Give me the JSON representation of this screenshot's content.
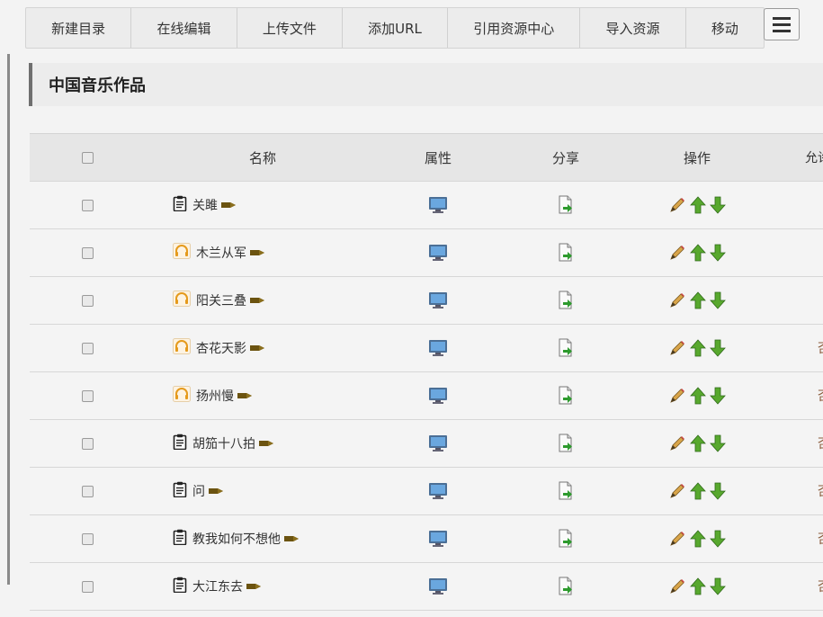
{
  "toolbar": {
    "buttons": [
      "新建目录",
      "在线编辑",
      "上传文件",
      "添加URL",
      "引用资源中心",
      "导入资源",
      "移动"
    ]
  },
  "section": {
    "title": "中国音乐作品"
  },
  "table": {
    "headers": {
      "name": "名称",
      "attr": "属性",
      "share": "分享",
      "ops": "操作",
      "allow": "允许"
    },
    "rows": [
      {
        "name": "关雎",
        "icon": "clipboard-icon",
        "allow": ""
      },
      {
        "name": "木兰从军",
        "icon": "headphones-icon",
        "allow": ""
      },
      {
        "name": "阳关三叠",
        "icon": "headphones-icon",
        "allow": ""
      },
      {
        "name": "杏花天影",
        "icon": "headphones-icon",
        "allow": "否"
      },
      {
        "name": "扬州慢",
        "icon": "headphones-icon",
        "allow": "否"
      },
      {
        "name": "胡笳十八拍",
        "icon": "clipboard-icon",
        "allow": "否"
      },
      {
        "name": "问",
        "icon": "clipboard-icon",
        "allow": "否"
      },
      {
        "name": "教我如何不想他",
        "icon": "clipboard-icon",
        "allow": "否"
      },
      {
        "name": "大江东去",
        "icon": "clipboard-icon",
        "allow": "否"
      }
    ]
  }
}
